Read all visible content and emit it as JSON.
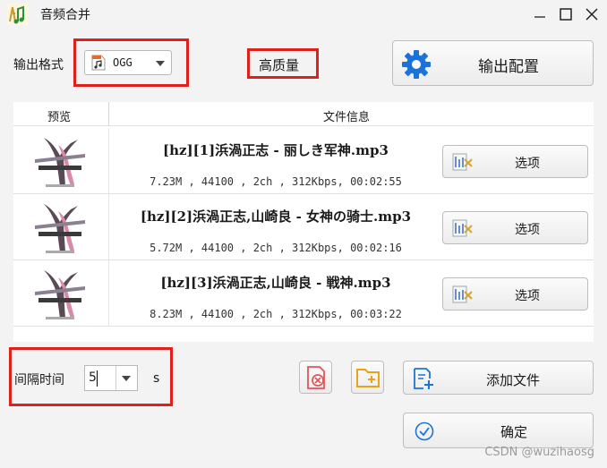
{
  "window": {
    "title": "音频合并"
  },
  "format": {
    "label": "输出格式",
    "selected": "OGG",
    "icon": "music-file-icon"
  },
  "quality": {
    "label": "高质量"
  },
  "config_button": {
    "label": "输出配置",
    "icon": "gear-icon"
  },
  "table": {
    "headers": [
      "预览",
      "文件信息"
    ],
    "rows": [
      {
        "name": "[hz][1]浜渦正志 - 丽しき军神.mp3",
        "meta": "7.23M , 44100 , 2ch , 312Kbps, 00:02:55",
        "option_label": "选项"
      },
      {
        "name": "[hz][2]浜渦正志,山崎良 - 女神の骑士.mp3",
        "meta": "5.72M , 44100 , 2ch , 312Kbps, 00:02:16",
        "option_label": "选项"
      },
      {
        "name": "[hz][3]浜渦正志,山崎良 - 戦神.mp3",
        "meta": "8.23M , 44100 , 2ch , 312Kbps, 00:03:22",
        "option_label": "选项"
      }
    ]
  },
  "interval": {
    "label": "间隔时间",
    "value": "5",
    "unit": "s"
  },
  "actions": {
    "remove_icon": "delete-file-icon",
    "add_folder_icon": "add-folder-icon",
    "add_file_label": "添加文件",
    "confirm_label": "确定"
  },
  "watermark": "CSDN @wuzihaosg",
  "colors": {
    "accent": "#1a73d9",
    "highlight": "#e0211b",
    "remove": "#e0565b",
    "folder": "#e8a317"
  }
}
